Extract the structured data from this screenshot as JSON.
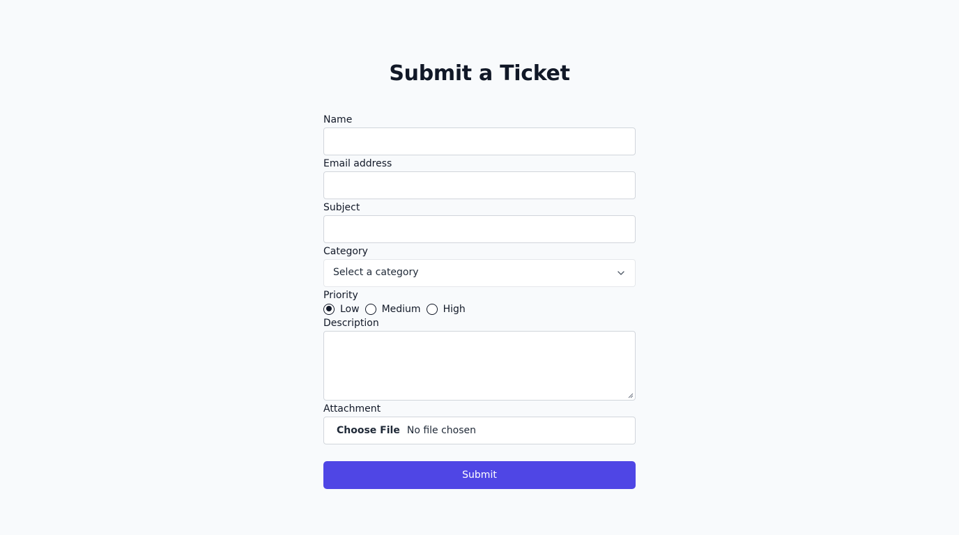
{
  "page": {
    "title": "Submit a Ticket"
  },
  "form": {
    "name": {
      "label": "Name",
      "value": ""
    },
    "email": {
      "label": "Email address",
      "value": ""
    },
    "subject": {
      "label": "Subject",
      "value": ""
    },
    "category": {
      "label": "Category",
      "selected": "Select a category"
    },
    "priority": {
      "label": "Priority",
      "options": [
        "Low",
        "Medium",
        "High"
      ],
      "selected": "Low"
    },
    "description": {
      "label": "Description",
      "value": ""
    },
    "attachment": {
      "label": "Attachment",
      "button_label": "Choose File",
      "status": "No file chosen"
    },
    "submit_label": "Submit"
  },
  "colors": {
    "background": "#f8fafc",
    "primary": "#4f46e5",
    "text": "#111827",
    "border": "#d1d5db"
  }
}
